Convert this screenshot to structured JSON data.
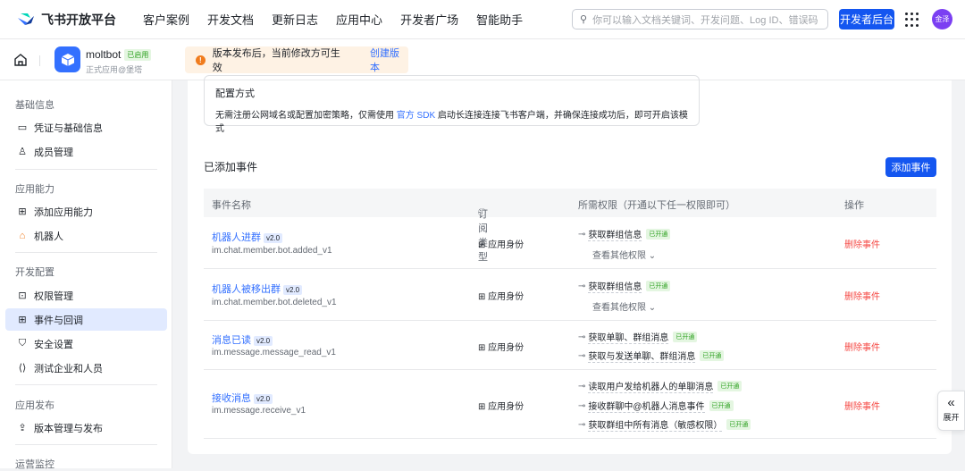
{
  "top": {
    "brand": "飞书开放平台",
    "nav": [
      "客户案例",
      "开发文档",
      "更新日志",
      "应用中心",
      "开发者广场",
      "智能助手"
    ],
    "search_placeholder": "你可以输入文档关键词、开发问题、Log ID、错误码",
    "dev_button": "开发者后台",
    "avatar": "金泽"
  },
  "app": {
    "name": "moltbot",
    "status": "已启用",
    "subtitle": "正式应用@堡塔",
    "notice": "版本发布后，当前修改方可生效",
    "notice_link": "创建版本"
  },
  "sidebar": {
    "sections": [
      {
        "title": "基础信息",
        "items": [
          "凭证与基础信息",
          "成员管理"
        ]
      },
      {
        "title": "应用能力",
        "items": [
          "添加应用能力",
          "机器人"
        ]
      },
      {
        "title": "开发配置",
        "items": [
          "权限管理",
          "事件与回调",
          "安全设置",
          "测试企业和人员"
        ]
      },
      {
        "title": "应用发布",
        "items": [
          "版本管理与发布"
        ]
      },
      {
        "title": "运营监控",
        "items": []
      }
    ],
    "active": "事件与回调"
  },
  "config": {
    "title": "配置方式",
    "text_pre": "无需注册公网域名或配置加密策略，仅需使用 ",
    "link": "官方 SDK",
    "text_post": " 启动长连接连接飞书客户端，并确保连接成功后，即可开启该模式"
  },
  "events": {
    "title": "已添加事件",
    "add_button": "添加事件",
    "headers": [
      "事件名称",
      "订阅类型",
      "所需权限（开通以下任一权限即可）",
      "操作"
    ],
    "rows": [
      {
        "name": "机器人进群",
        "version": "v2.0",
        "key": "im.chat.member.bot.added_v1",
        "type": "应用身份",
        "perms": [
          {
            "label": "获取群组信息",
            "status": "已开通"
          }
        ],
        "more": "查看其他权限",
        "action": "删除事件"
      },
      {
        "name": "机器人被移出群",
        "version": "v2.0",
        "key": "im.chat.member.bot.deleted_v1",
        "type": "应用身份",
        "perms": [
          {
            "label": "获取群组信息",
            "status": "已开通"
          }
        ],
        "more": "查看其他权限",
        "action": "删除事件"
      },
      {
        "name": "消息已读",
        "version": "v2.0",
        "key": "im.message.message_read_v1",
        "type": "应用身份",
        "perms": [
          {
            "label": "获取单聊、群组消息",
            "status": "已开通"
          },
          {
            "label": "获取与发送单聊、群组消息",
            "status": "已开通"
          }
        ],
        "action": "删除事件"
      },
      {
        "name": "接收消息",
        "version": "v2.0",
        "key": "im.message.receive_v1",
        "type": "应用身份",
        "perms": [
          {
            "label": "读取用户发给机器人的单聊消息",
            "status": "已开通"
          },
          {
            "label": "接收群聊中@机器人消息事件",
            "status": "已开通"
          },
          {
            "label": "获取群组中所有消息（敏感权限）",
            "status": "已开通"
          }
        ],
        "action": "删除事件"
      }
    ]
  },
  "expand": {
    "label": "展开"
  }
}
